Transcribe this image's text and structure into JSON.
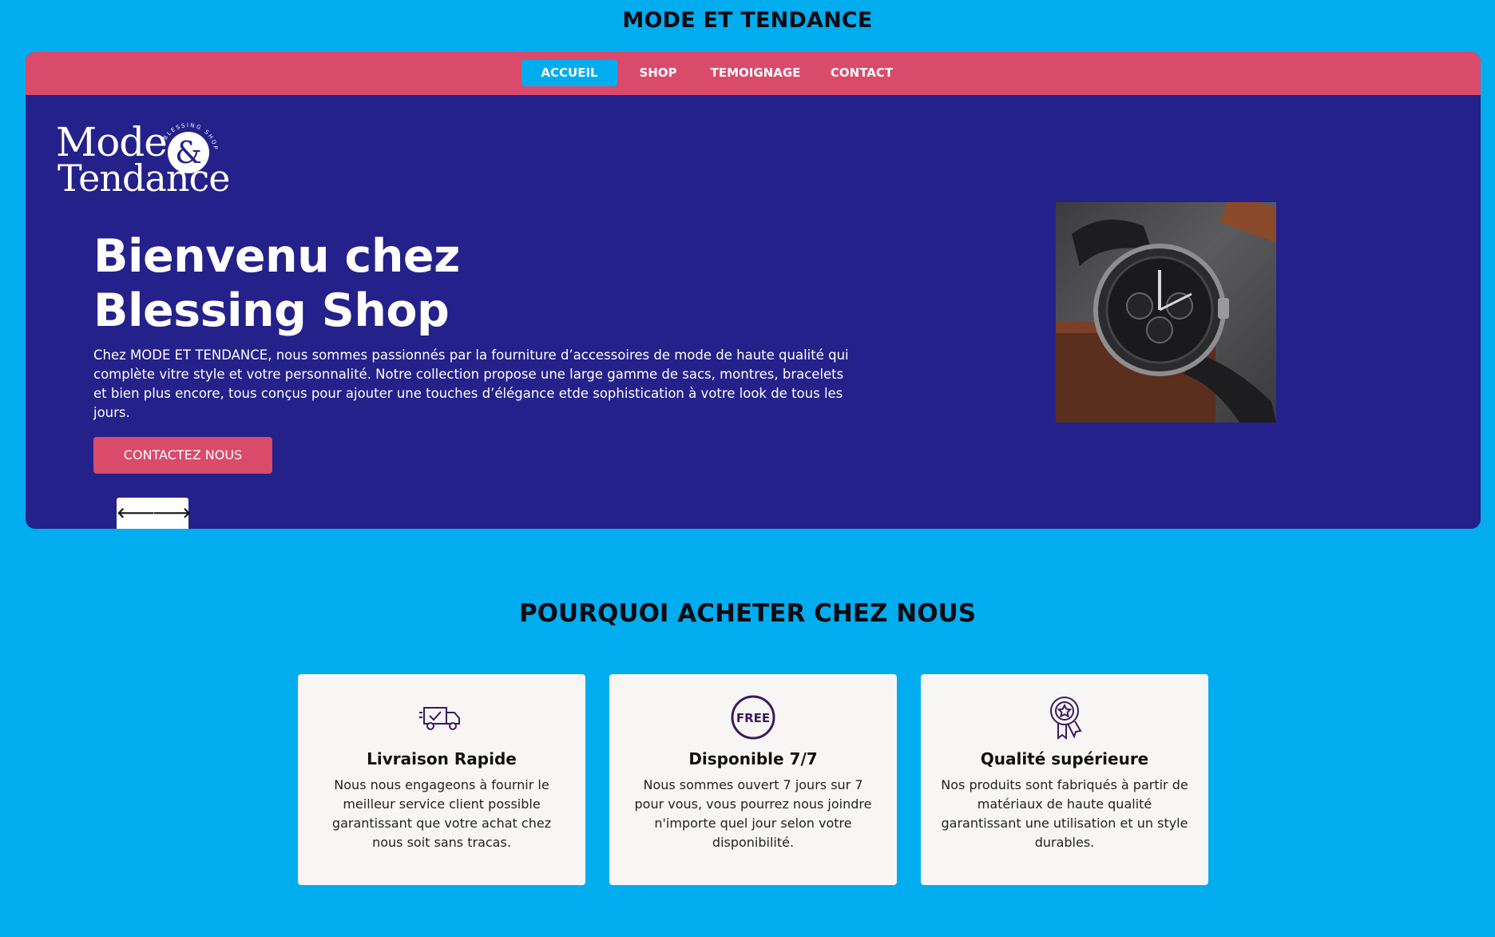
{
  "site": {
    "title": "MODE ET TENDANCE"
  },
  "nav": {
    "items": [
      {
        "label": "ACCUEIL",
        "active": true
      },
      {
        "label": "SHOP",
        "active": false
      },
      {
        "label": "TEMOIGNAGE",
        "active": false
      },
      {
        "label": "CONTACT",
        "active": false
      }
    ]
  },
  "logo": {
    "line1": "Mode",
    "line2": "Tendance",
    "ampersand": "&",
    "ring_text": "BLESSING SHOP"
  },
  "hero": {
    "heading_line1": "Bienvenu chez",
    "heading_line2": "Blessing Shop",
    "text": "Chez MODE ET TENDANCE, nous sommes passionnés par la fourniture d’accessoires de mode de haute qualité qui complète vitre style et votre personnalité. Notre collection propose une large gamme de sacs, montres, bracelets et bien plus encore, tous conçus pour ajouter une touches d’élégance etde sophistication à votre look de tous les jours.",
    "cta_label": "CONTACTEZ NOUS",
    "prev_arrow": "🡐",
    "next_arrow": "🡒",
    "image_icon": "wristwatch-photo"
  },
  "features": {
    "title": "POURQUOI ACHETER CHEZ NOUS",
    "cards": [
      {
        "icon": "delivery-truck-icon",
        "title": "Livraison Rapide",
        "text": "Nous nous engageons à fournir le meilleur service client possible garantissant que votre achat chez nous soit sans tracas."
      },
      {
        "icon": "free-badge-icon",
        "icon_text": "FREE",
        "title": "Disponible 7/7",
        "text": "Nous sommes ouvert 7 jours sur 7 pour vous, vous pourrez nous joindre n'importe quel jour selon votre disponibilité."
      },
      {
        "icon": "quality-award-icon",
        "title": "Qualité supérieure",
        "text": "Nos produits sont fabriqués à partir de matériaux de haute qualité garantissant une utilisation et un style durables."
      }
    ]
  },
  "colors": {
    "page_bg": "#01adef",
    "hero_bg": "#24218b",
    "accent_pink": "#da4a6a",
    "card_bg": "#f8f6f4",
    "icon_purple": "#3a1a5c"
  }
}
